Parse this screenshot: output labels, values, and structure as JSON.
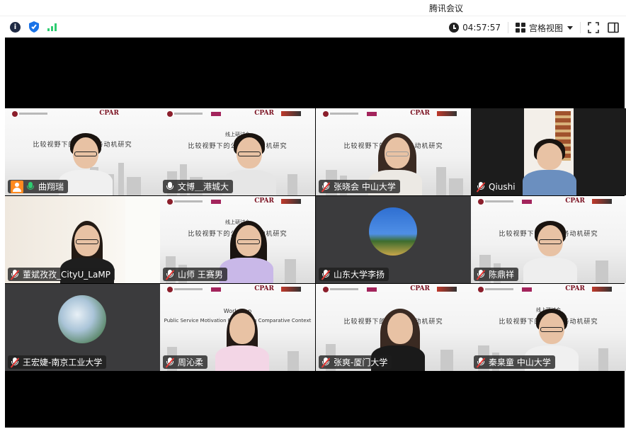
{
  "app": {
    "title": "腾讯会议"
  },
  "toolbar": {
    "left_icons": [
      "info-icon",
      "shield-icon",
      "signal-icon"
    ],
    "timer": "04:57:57",
    "view_label": "宫格视图",
    "right_icons": [
      "fullscreen-icon",
      "sidebar-toggle-icon"
    ]
  },
  "slide_texts": {
    "cpar": "CPAR",
    "subtitle": "线上研讨会",
    "main_title": "比较视野下的公共服务动机研究",
    "english_title": "Public Service Motivation Research in Comparative Context",
    "workshop": "Workshop"
  },
  "participants": [
    {
      "name": "曲翔瑞",
      "mic": "on",
      "host": true,
      "active": true
    },
    {
      "name": "文博＿港城大",
      "mic": "on"
    },
    {
      "name": "张晓会 中山大学",
      "mic": "muted"
    },
    {
      "name": "Qiushi",
      "mic": "muted"
    },
    {
      "name": "董斌孜孜_CityU_LaMP",
      "mic": "muted"
    },
    {
      "name": "山师  王赛男",
      "mic": "muted"
    },
    {
      "name": "山东大学李扬",
      "mic": "muted"
    },
    {
      "name": "陈鼎祥",
      "mic": "muted"
    },
    {
      "name": "王宏婕-南京工业大学",
      "mic": "muted"
    },
    {
      "name": "周沁柔",
      "mic": "muted"
    },
    {
      "name": "张爽-厦门大学",
      "mic": "muted"
    },
    {
      "name": "秦臬童 中山大学",
      "mic": "muted"
    }
  ]
}
